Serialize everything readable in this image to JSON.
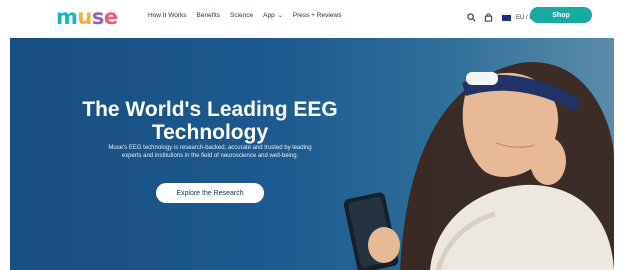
{
  "brand": {
    "logo_letters": [
      "m",
      "u",
      "s",
      "e"
    ]
  },
  "nav": {
    "items": [
      {
        "label": "How It Works"
      },
      {
        "label": "Benefits"
      },
      {
        "label": "Science"
      },
      {
        "label": "App"
      },
      {
        "label": "Press + Reviews"
      }
    ]
  },
  "header": {
    "region_label": "EU / UK Store",
    "shop_label": "Shop",
    "search_icon": "search-icon",
    "bag_icon": "shopping-bag-icon"
  },
  "hero": {
    "title": "The World's Leading EEG Technology",
    "body": "Muse's EEG technology is research-backed, accurate and trusted by leading experts and institutions in the field of neuroscience and well-being.",
    "cta": "Explore the Research"
  },
  "colors": {
    "brand_teal": "#18a9a0",
    "hero_blue": "#1d5a8f",
    "logo_m": "#17b6c4",
    "logo_u": "#f2b234",
    "logo_s": "#8e63b9",
    "logo_e": "#ef5a74"
  }
}
